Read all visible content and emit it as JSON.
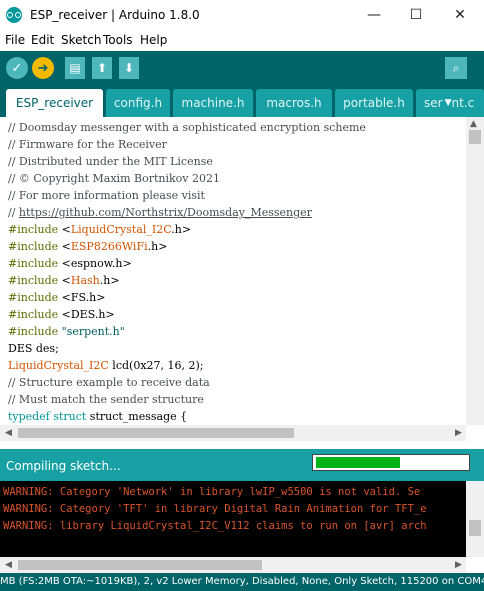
{
  "window": {
    "title": "ESP_receiver | Arduino 1.8.0",
    "minimize": "—",
    "maximize": "☐",
    "close": "✕"
  },
  "menu": [
    "File",
    "Edit",
    "Sketch",
    "Tools",
    "Help"
  ],
  "toolbar": {
    "verify": "✓",
    "upload": "➜",
    "new": "▤",
    "open": "⬆",
    "save": "⬇",
    "serial_monitor": "⌕"
  },
  "tabs": [
    "ESP_receiver",
    "config.h",
    "machine.h",
    "macros.h",
    "portable.h",
    "ser"
  ],
  "tab_partial_suffix": "nt.c",
  "tab_menu": "▼",
  "code": {
    "l1": "// Doomsday messenger with a sophisticated encryption scheme",
    "l2": "// Firmware for the Receiver",
    "l3": "// Distributed under the MIT License",
    "l4": "// © Copyright Maxim Bortnikov 2021",
    "l5": "// For more information please visit",
    "l6_prefix": "// ",
    "l6_link": "https://github.com/Northstrix/Doomsday_Messenger",
    "include": "#include",
    "i1_open": " <",
    "i1_lib": "LiquidCrystal_I2C",
    "i1_close": ".h>",
    "i2_open": " <",
    "i2_lib": "ESP8266WiFi",
    "i2_close": ".h>",
    "i3": " <espnow.h>",
    "i4_open": " <",
    "i4_lib": "Hash",
    "i4_close": ".h>",
    "i5": " <FS.h>",
    "i6": " <DES.h>",
    "i7": " \"serpent.h\"",
    "l14": "DES des;",
    "l15_type": "LiquidCrystal_I2C",
    "l15_rest": " lcd(0x27, 16, 2);",
    "l16": "// Structure example to receive data",
    "l17": "// Must match the sender structure",
    "l18_kw1": "typedef",
    "l18_kw2": "struct",
    "l18_rest": " struct_message {"
  },
  "status": {
    "text": "Compiling sketch...",
    "progress": 0.56
  },
  "console": [
    "WARNING: Category 'Network' in library lwIP_w5500 is not valid. Se",
    "WARNING: Category 'TFT' in library Digital Rain Animation for TFT_e",
    "WARNING: library LiquidCrystal_I2C_V112 claims to run on [avr] arch"
  ],
  "footer": "MB (FS:2MB OTA:~1019KB), 2, v2 Lower Memory, Disabled, None, Only Sketch, 115200 on COM4",
  "colors": {
    "toolbar": "#006468",
    "tab_inactive": "#17a1a5",
    "status": "#17a1a5",
    "progress": "#00b418",
    "warning": "#d9542b"
  }
}
